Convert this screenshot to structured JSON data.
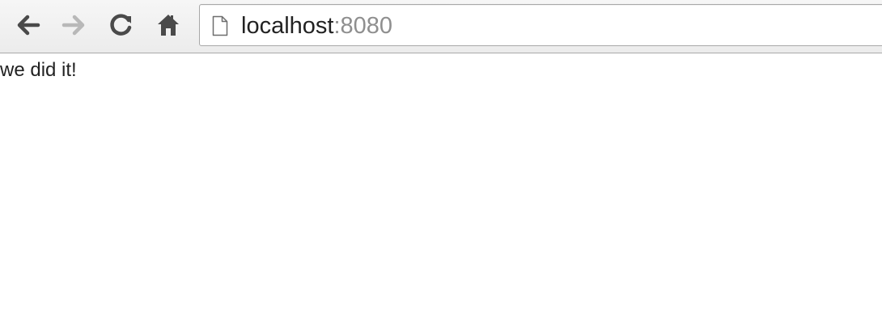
{
  "browser": {
    "url_host": "localhost",
    "url_port": ":8080",
    "icons": {
      "back": "back-arrow-icon",
      "forward": "forward-arrow-icon",
      "reload": "reload-icon",
      "home": "home-icon",
      "page": "page-icon"
    },
    "colors": {
      "icon_active": "#4a4a4a",
      "icon_disabled": "#b8b8b8",
      "port_text": "#8f8f8f"
    }
  },
  "page": {
    "body_text": "we did it!"
  }
}
